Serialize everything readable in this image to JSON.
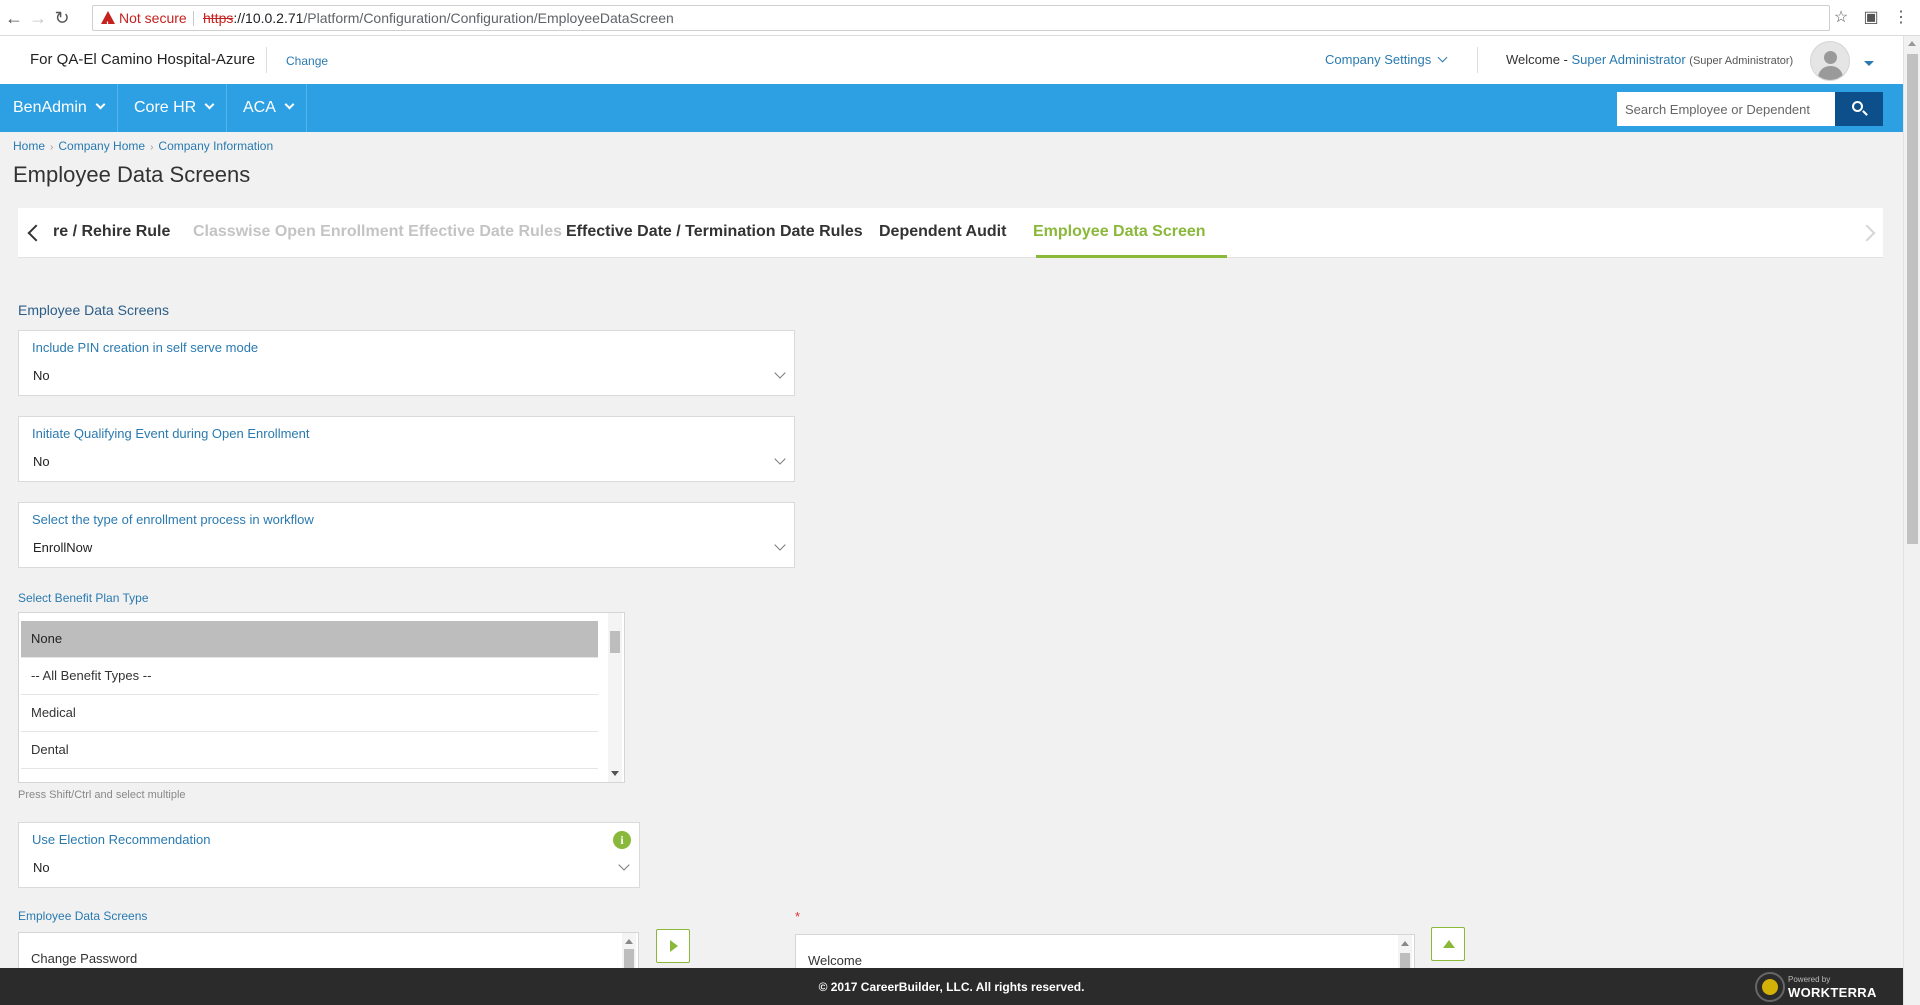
{
  "browser": {
    "not_secure": "Not secure",
    "url_protocol": "https",
    "url_host": "://10.0.2.71",
    "url_path": "/Platform/Configuration/Configuration/EmployeeDataScreen"
  },
  "company_bar": {
    "company_name": "For QA-El Camino Hospital-Azure",
    "change_label": "Change",
    "company_settings": "Company Settings",
    "welcome_prefix": "Welcome - ",
    "user_name": "Super Administrator",
    "user_role": "(Super Administrator)"
  },
  "main_nav": {
    "items": [
      {
        "label": "BenAdmin"
      },
      {
        "label": "Core HR"
      },
      {
        "label": "ACA"
      }
    ],
    "search_placeholder": "Search Employee or Dependent"
  },
  "breadcrumb": [
    "Home",
    "Company Home",
    "Company Information"
  ],
  "page_title": "Employee Data Screens",
  "tabs": [
    {
      "label": "re / Rehire Rule",
      "state": "normal"
    },
    {
      "label": "Classwise Open Enrollment Effective Date Rules",
      "state": "disabled"
    },
    {
      "label": "Effective Date / Termination Date Rules",
      "state": "normal"
    },
    {
      "label": "Dependent Audit",
      "state": "normal"
    },
    {
      "label": "Employee Data Screen",
      "state": "active"
    }
  ],
  "form": {
    "section_heading": "Employee Data Screens",
    "fields": [
      {
        "label": "Include PIN creation in self serve mode",
        "value": "No"
      },
      {
        "label": "Initiate Qualifying Event during Open Enrollment",
        "value": "No"
      },
      {
        "label": "Select the type of enrollment process in workflow",
        "value": "EnrollNow"
      }
    ],
    "benefit_plan_type": {
      "label": "Select Benefit Plan Type",
      "options": [
        "None",
        "-- All Benefit Types --",
        "Medical",
        "Dental"
      ],
      "selected": "None",
      "hint": "Press Shift/Ctrl and select multiple"
    },
    "election_recommendation": {
      "label": "Use Election Recommendation",
      "value": "No",
      "info_icon": "i"
    },
    "employee_data_screens": {
      "label": "Employee Data Screens",
      "available": [
        "Change Password"
      ],
      "required_marker": "*",
      "selected": [
        "Welcome"
      ]
    }
  },
  "footer": {
    "copyright": "© 2017 CareerBuilder, LLC. All rights reserved.",
    "powered_by": "Powered by",
    "brand": "WORKTERRA"
  },
  "colors": {
    "nav_blue": "#2d9fe3",
    "accent_green": "#8ab83a",
    "link_blue": "#2a7ab0",
    "search_button": "#0d4f8a",
    "footer": "#2b2b2b"
  }
}
